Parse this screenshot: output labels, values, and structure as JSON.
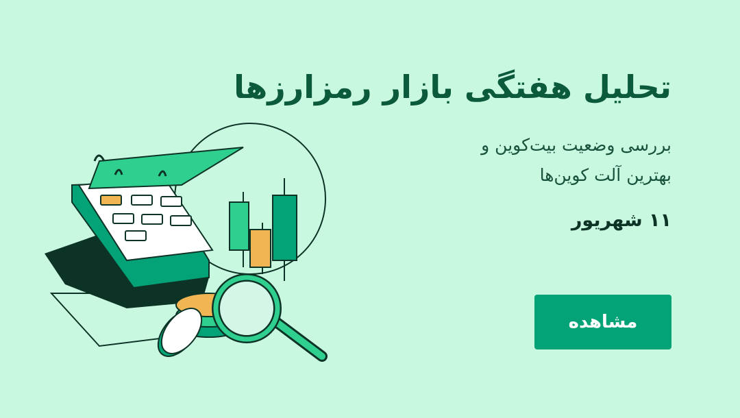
{
  "banner": {
    "title": "تحلیل هفتگی بازار رمزارزها",
    "subtitle_line1": "بررسی وضعیت بیت‌کوین و",
    "subtitle_line2": "بهترین آلت کوین‌ها",
    "date": "۱۱ شهریور",
    "cta_label": "مشاهده"
  },
  "colors": {
    "background": "#c9f8e0",
    "title": "#0b5a3c",
    "accent": "#04a277",
    "dark": "#0d3326"
  },
  "illustration": {
    "icons": [
      "calendar-icon",
      "candlestick-chart-icon",
      "coins-icon",
      "magnifying-glass-icon"
    ]
  }
}
